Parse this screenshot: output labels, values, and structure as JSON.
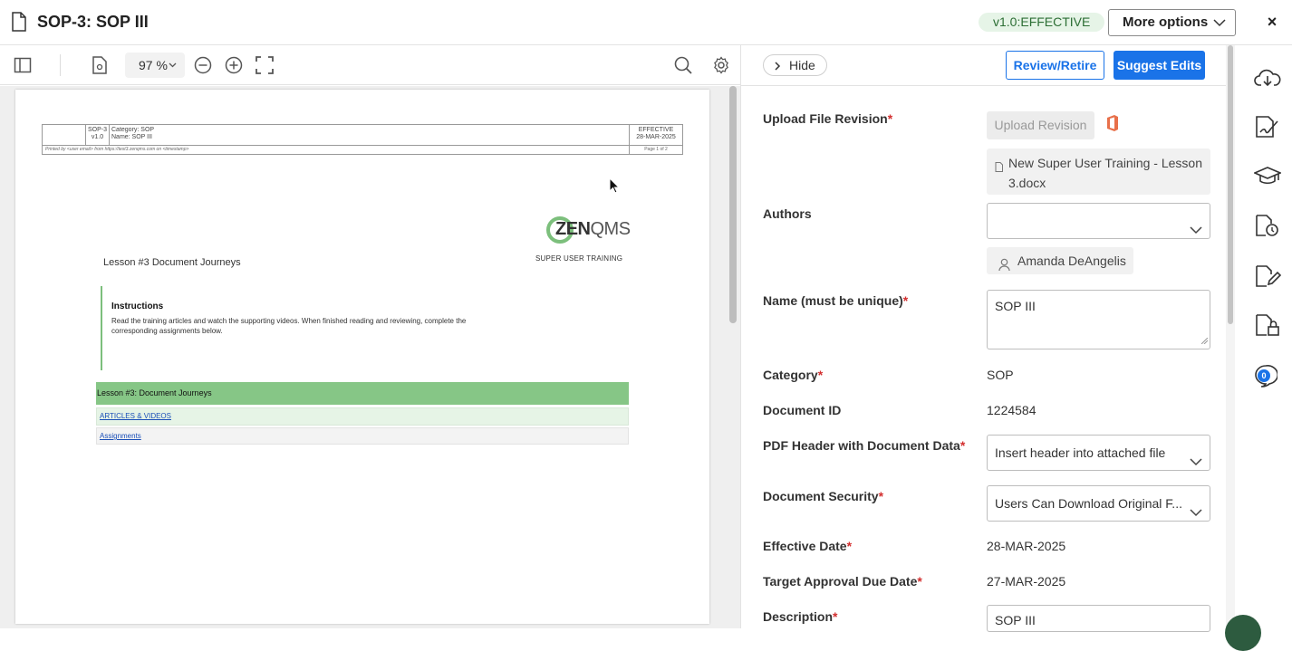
{
  "header": {
    "title": "SOP-3: SOP III",
    "status": "v1.0:EFFECTIVE",
    "more_options": "More options",
    "close": "×"
  },
  "viewer": {
    "zoom": "97 %",
    "page": {
      "hdr_id": "SOP-3",
      "hdr_version": "v1.0",
      "hdr_category": "Category: SOP",
      "hdr_name": "Name: SOP III",
      "hdr_status": "EFFECTIVE",
      "hdr_date": "28-MAR-2025",
      "printed_by": "Printed by <user email> from https://test3.zenqms.com on <timestamp>",
      "page_of": "Page 1 of 2",
      "logo_a": "ZEN",
      "logo_b": "QMS",
      "logo_sub": "SUPER USER TRAINING",
      "lesson_title": "Lesson #3 Document Journeys",
      "instructions_title": "Instructions",
      "instructions_body": "Read the training articles and watch the supporting videos. When finished reading and reviewing, complete the corresponding assignments below.",
      "table_header": "Lesson #3: Document Journeys",
      "link_articles": "ARTICLES & VIDEOS",
      "link_assignments": "Assignments"
    }
  },
  "panel": {
    "hide": "Hide",
    "review_retire": "Review/Retire",
    "suggest_edits": "Suggest Edits",
    "upload_label": "Upload File Revision",
    "upload_button": "Upload Revision",
    "file_name": "New Super User Training - Lesson 3.docx",
    "authors_label": "Authors",
    "author_name": "Amanda DeAngelis",
    "name_label": "Name (must be unique)",
    "name_value": "SOP III",
    "category_label": "Category",
    "category_value": "SOP",
    "docid_label": "Document ID",
    "docid_value": "1224584",
    "pdfheader_label": "PDF Header with Document Data",
    "pdfheader_value": "Insert header into attached file",
    "security_label": "Document Security",
    "security_value": "Users Can Download Original F...",
    "effective_label": "Effective Date",
    "effective_value": "28-MAR-2025",
    "target_label": "Target Approval Due Date",
    "target_value": "27-MAR-2025",
    "description_label": "Description",
    "description_value": "SOP III",
    "required_mark": "*"
  },
  "rail": {
    "comments_count": "0"
  },
  "colors": {
    "accent": "#1a73e8",
    "status_bg": "#e6f4e7",
    "status_text": "#2c6e34",
    "required": "#d32f2f",
    "zen_green": "#7cbf7c"
  }
}
